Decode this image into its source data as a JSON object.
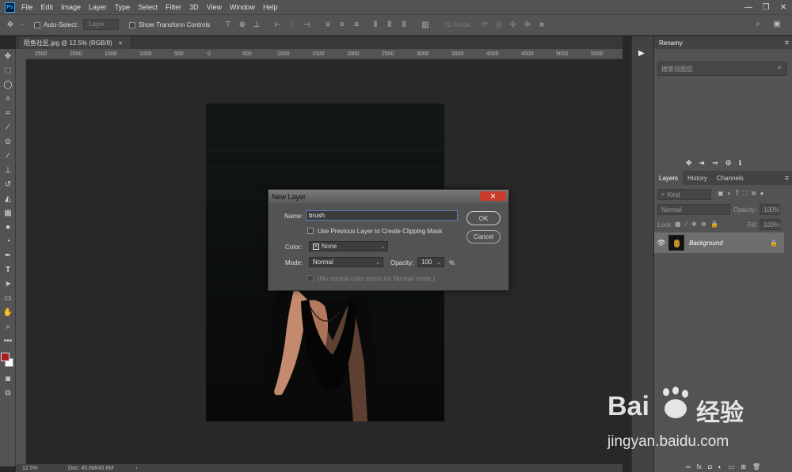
{
  "menubar": {
    "logo": "Ps",
    "items": [
      "File",
      "Edit",
      "Image",
      "Layer",
      "Type",
      "Select",
      "Filter",
      "3D",
      "View",
      "Window",
      "Help"
    ]
  },
  "options": {
    "auto_select_label": "Auto-Select:",
    "auto_select_value": "Layer",
    "transform_label": "Show Transform Controls",
    "mode_3d_label": "3D Mode:"
  },
  "document": {
    "tab_title": "陌鱼社区.jpg @ 12.5% (RGB/8)",
    "tab_close": "×"
  },
  "ruler": {
    "labels": [
      "2500",
      "2000",
      "1500",
      "1000",
      "500",
      "0",
      "500",
      "1000",
      "1500",
      "2000",
      "2500",
      "3000",
      "3500",
      "4000",
      "4500",
      "5000",
      "5500"
    ]
  },
  "status": {
    "zoom": "12.5%",
    "doc": "Doc: 45.6M/45.6M"
  },
  "renamy": {
    "title": "Renamy",
    "search_placeholder": "搜索视图层"
  },
  "layers_panel": {
    "tabs": [
      "Layers",
      "History",
      "Channels"
    ],
    "kind_label": "Kind",
    "blend_mode": "Normal",
    "opacity_label": "Opacity:",
    "opacity_value": "100%",
    "lock_label": "Lock:",
    "fill_label": "Fill:",
    "fill_value": "100%",
    "layer_name": "Background"
  },
  "dialog": {
    "title": "New Layer",
    "close": "✕",
    "name_label": "Name:",
    "name_value": "brush",
    "clipping_label": "Use Previous Layer to Create Clipping Mask",
    "color_label": "Color:",
    "color_value": "None",
    "mode_label": "Mode:",
    "mode_value": "Normal",
    "opacity_label": "Opacity:",
    "opacity_value": "100",
    "percent": "%",
    "neutral_label": "(No neutral color exists for Normal mode.)",
    "ok_label": "OK",
    "cancel_label": "Cancel"
  },
  "watermark": {
    "brand": "Bai",
    "cn": "经验",
    "url": "jingyan.baidu.com"
  },
  "colors": {
    "foreground": "#a81e1e",
    "background": "#ffffff",
    "accent": "#31a8ff"
  }
}
